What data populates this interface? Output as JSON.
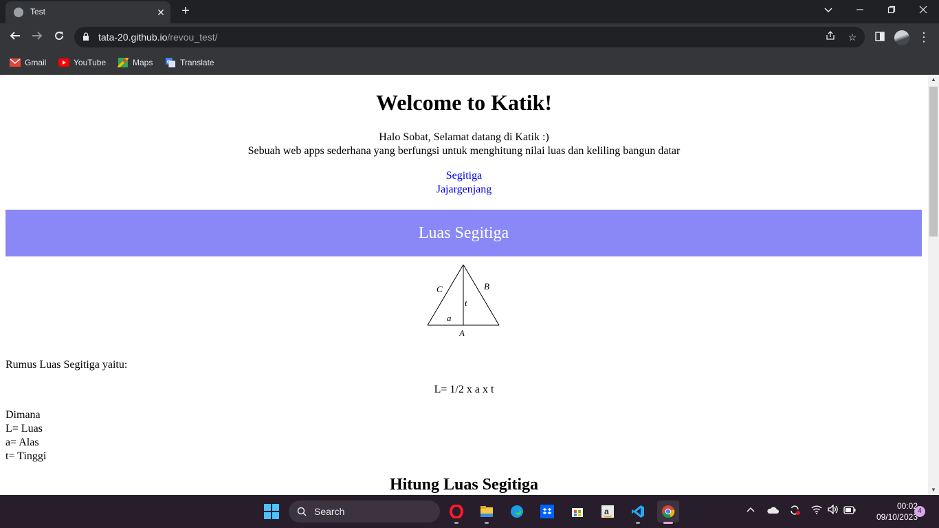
{
  "browser": {
    "tab": {
      "title": "Test"
    },
    "address": {
      "domain": "tata-20.github.io",
      "path": "/revou_test/"
    },
    "bookmarks": [
      {
        "label": "Gmail",
        "icon": "gmail-icon"
      },
      {
        "label": "YouTube",
        "icon": "youtube-icon"
      },
      {
        "label": "Maps",
        "icon": "maps-icon"
      },
      {
        "label": "Translate",
        "icon": "translate-icon"
      }
    ]
  },
  "page": {
    "heading": "Welcome to Katik!",
    "intro_line1": "Halo Sobat, Selamat datang di Katik :)",
    "intro_line2": "Sebuah web apps sederhana yang berfungsi untuk menghitung nilai luas dan keliling bangun datar",
    "nav_links": [
      "Segitiga",
      "Jajargenjang"
    ],
    "section_title": "Luas Segitiga",
    "figure_labels": {
      "c": "C",
      "b": "B",
      "t": "t",
      "a": "a",
      "base": "A"
    },
    "formula_intro": "Rumus Luas Segitiga yaitu:",
    "formula": "L= 1/2 x a x t",
    "definitions": [
      "Dimana",
      "L= Luas",
      "a= Alas",
      "t= Tinggi"
    ],
    "calc_heading": "Hitung Luas Segitiga"
  },
  "taskbar": {
    "search_label": "Search",
    "apps": [
      "opera-icon",
      "file-explorer-icon",
      "edge-icon",
      "dropbox-icon",
      "store-icon",
      "amazon-icon",
      "vscode-icon",
      "chrome-icon"
    ],
    "time": "00:02",
    "date": "09/10/2023",
    "notification_count": "4"
  },
  "colors": {
    "banner": "#8a87f7",
    "link": "#0000ee",
    "chrome_dark": "#202124",
    "chrome_toolbar": "#35363a",
    "taskbar": "#271d2b"
  }
}
